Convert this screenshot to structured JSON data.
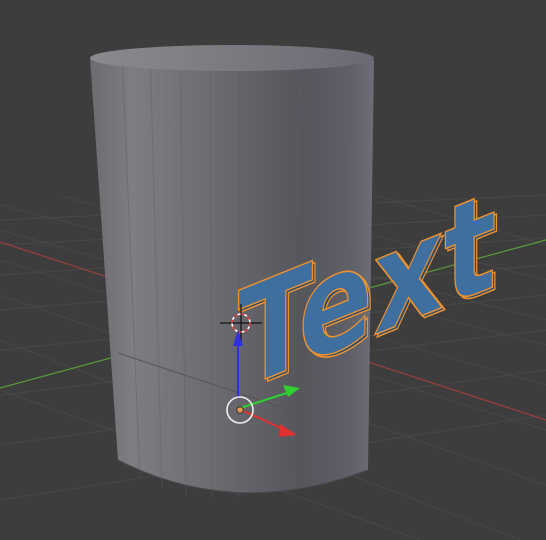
{
  "viewport": {
    "background_color": "#3d3d3d",
    "grid_color": "#484848",
    "x_axis_color": "#9c3d3d",
    "y_axis_color": "#5a9c3d",
    "cylinder_color": "#7b7b82",
    "text_object": {
      "label": "Text",
      "fill_color": "#3f6f9f",
      "extrude_color": "#2d4d6d",
      "outline_color": "#f0922e"
    },
    "gizmo": {
      "x_arrow_color": "#e03030",
      "y_arrow_color": "#30d030",
      "z_arrow_color": "#3030e0",
      "origin_color": "#e89a4a"
    },
    "cursor_3d": {
      "ring_color": "#e03a3a"
    }
  }
}
